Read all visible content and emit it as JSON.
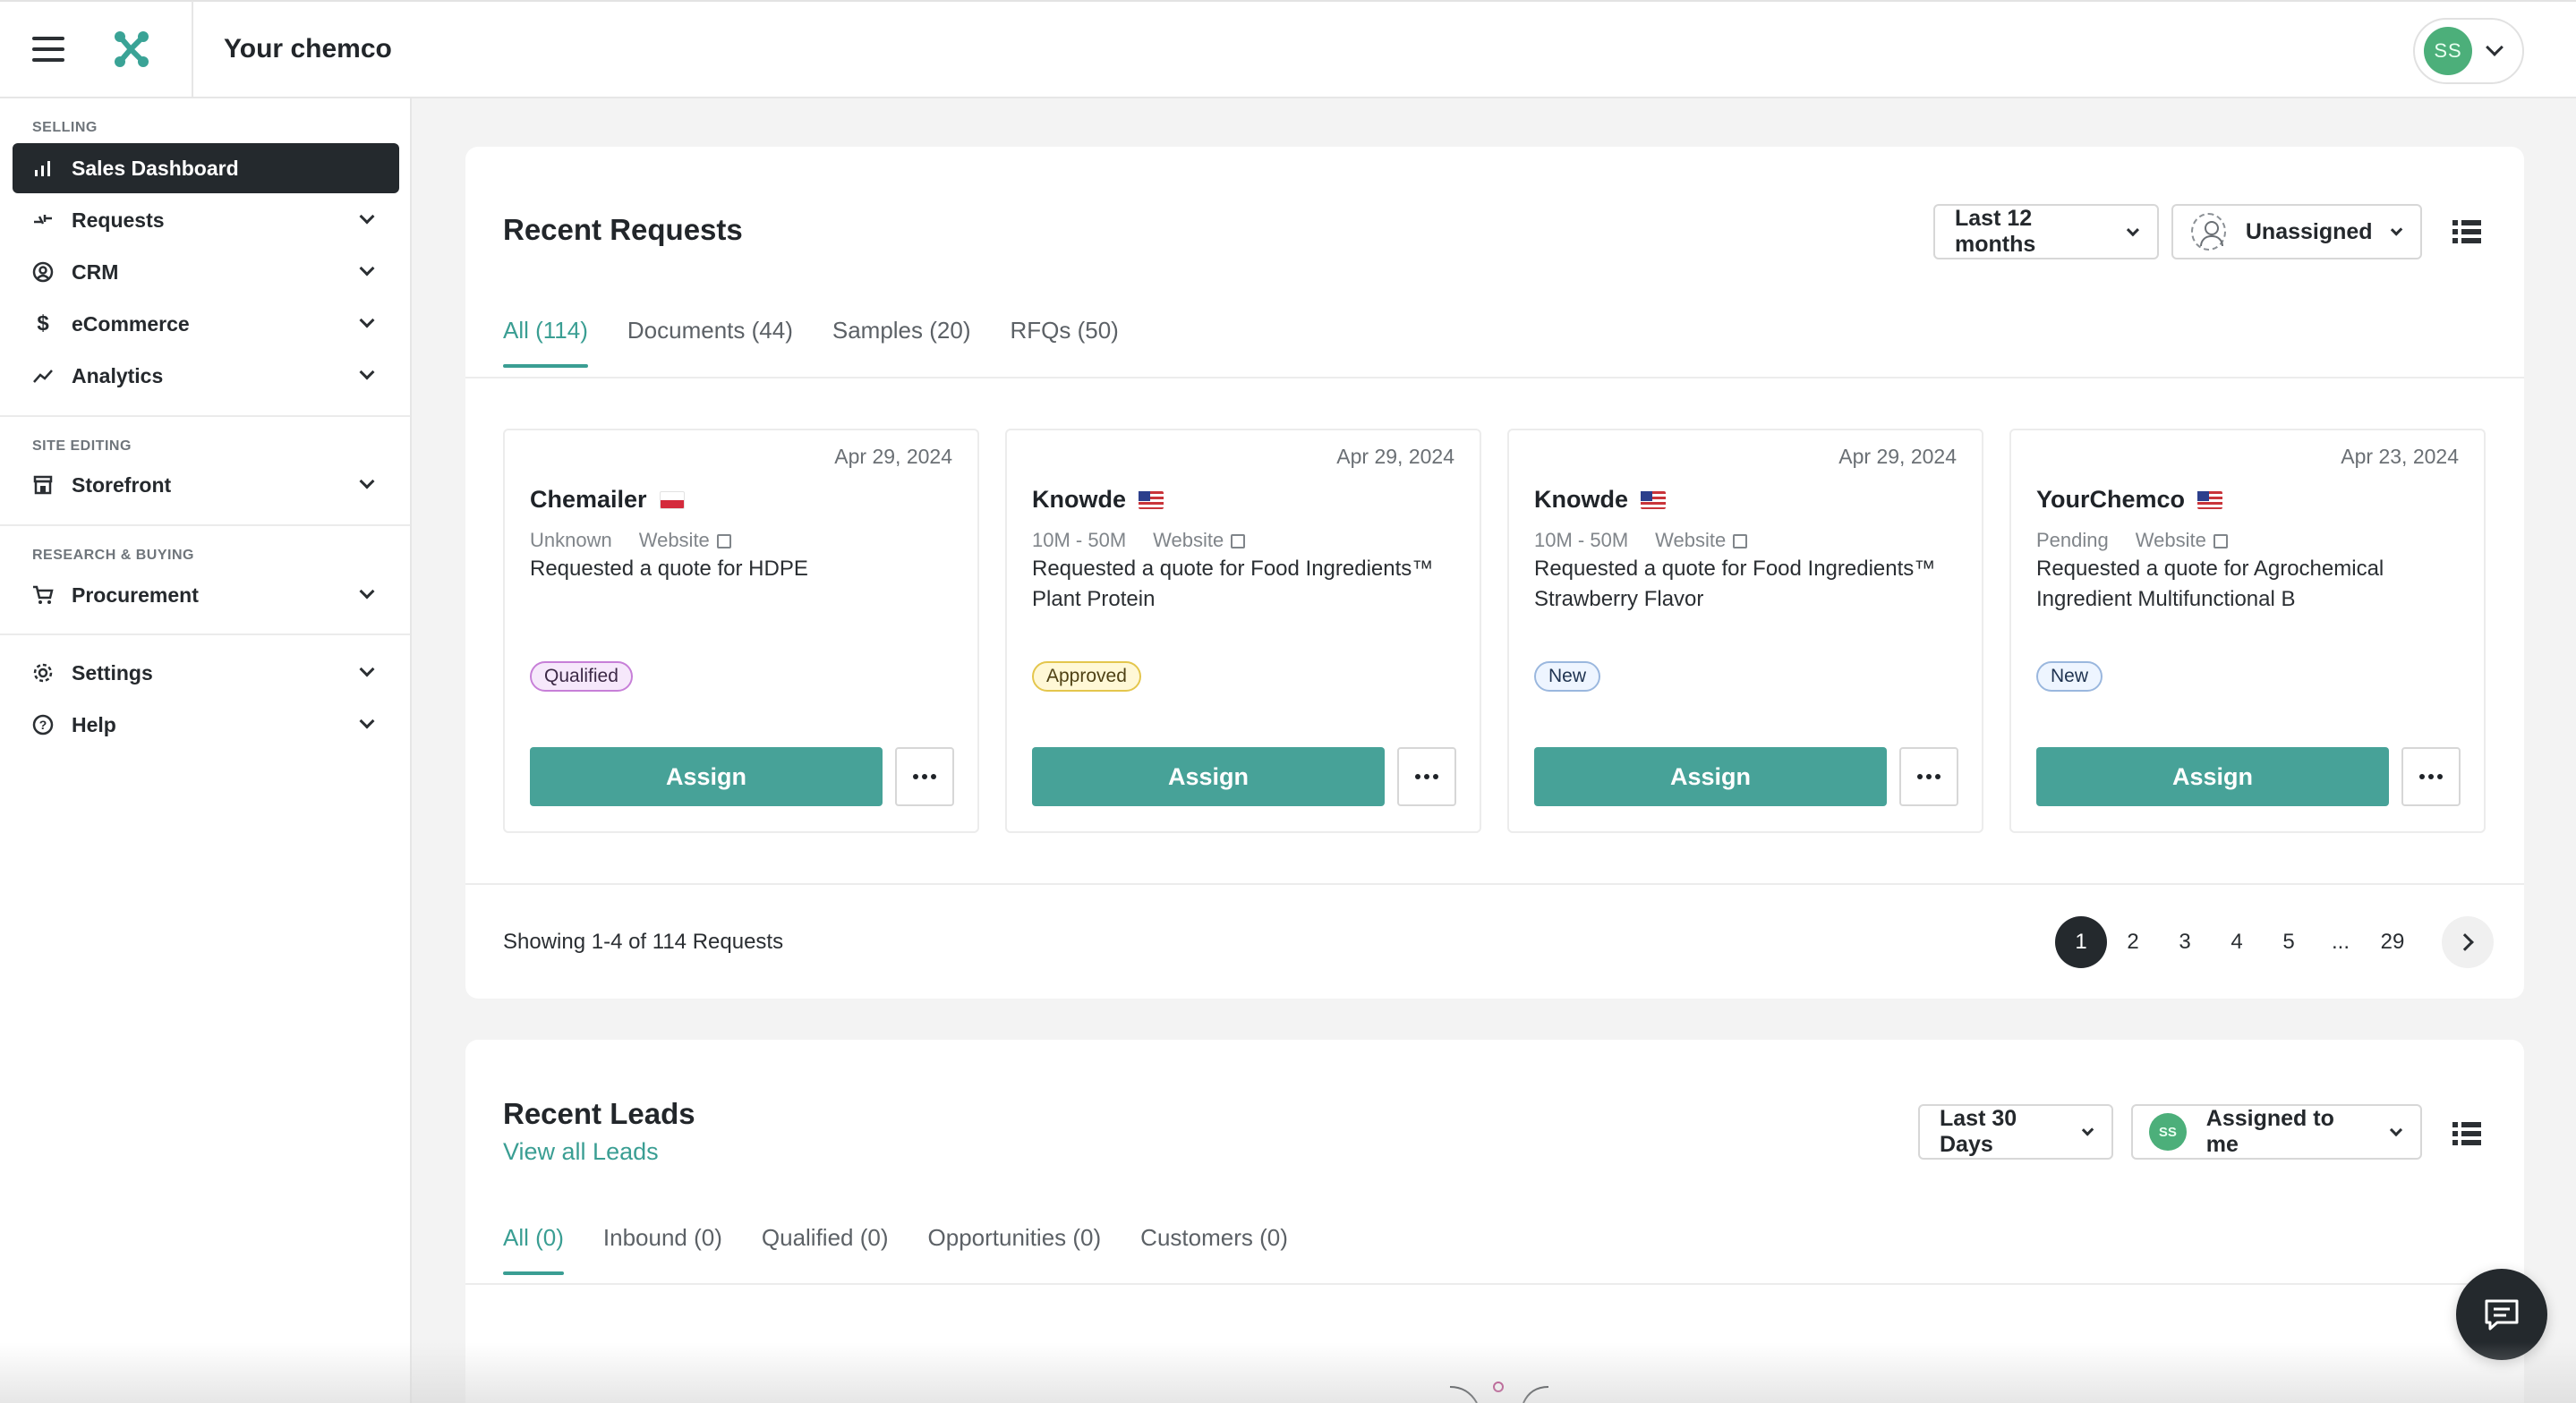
{
  "header": {
    "title": "Your chemco",
    "user_initials": "SS"
  },
  "sidebar": {
    "sections": [
      {
        "label": "SELLING"
      },
      {
        "label": "SITE EDITING"
      },
      {
        "label": "RESEARCH & BUYING"
      }
    ],
    "items": [
      {
        "label": "Sales Dashboard",
        "icon": "bar-chart-icon",
        "active": true
      },
      {
        "label": "Requests",
        "icon": "swap-icon"
      },
      {
        "label": "CRM",
        "icon": "user-circle-icon"
      },
      {
        "label": "eCommerce",
        "icon": "dollar-icon"
      },
      {
        "label": "Analytics",
        "icon": "trend-icon"
      },
      {
        "label": "Storefront",
        "icon": "storefront-icon"
      },
      {
        "label": "Procurement",
        "icon": "cart-icon"
      },
      {
        "label": "Settings",
        "icon": "gear-icon"
      },
      {
        "label": "Help",
        "icon": "help-icon"
      }
    ]
  },
  "requests": {
    "title": "Recent Requests",
    "period": "Last 12 months",
    "assignee": "Unassigned",
    "tabs": [
      "All (114)",
      "Documents (44)",
      "Samples (20)",
      "RFQs (50)"
    ],
    "cards": [
      {
        "date": "Apr 29, 2024",
        "company": "Chemailer",
        "flag": "PL",
        "size": "Unknown",
        "source": "Website",
        "description": "Requested a quote for HDPE",
        "status": "Qualified",
        "action": "Assign"
      },
      {
        "date": "Apr 29, 2024",
        "company": "Knowde",
        "flag": "US",
        "size": "10M - 50M",
        "source": "Website",
        "description": "Requested a quote for Food Ingredients™ Plant Protein",
        "status": "Approved",
        "action": "Assign"
      },
      {
        "date": "Apr 29, 2024",
        "company": "Knowde",
        "flag": "US",
        "size": "10M - 50M",
        "source": "Website",
        "description": "Requested a quote for Food Ingredients™ Strawberry Flavor",
        "status": "New",
        "action": "Assign"
      },
      {
        "date": "Apr 23, 2024",
        "company": "YourChemco",
        "flag": "US",
        "size": "Pending",
        "source": "Website",
        "description": "Requested a quote for Agrochemical Ingredient Multifunctional B",
        "status": "New",
        "action": "Assign"
      }
    ],
    "showing": "Showing 1-4 of 114 Requests",
    "pages": [
      "1",
      "2",
      "3",
      "4",
      "5",
      "...",
      "29"
    ],
    "current_page": "1"
  },
  "leads": {
    "title": "Recent Leads",
    "view_all": "View all Leads",
    "period": "Last 30 Days",
    "assignee": "Assigned to me",
    "assignee_initials": "SS",
    "tabs": [
      "All (0)",
      "Inbound (0)",
      "Qualified (0)",
      "Opportunities (0)",
      "Customers (0)"
    ]
  },
  "colors": {
    "accent": "#47a298",
    "dark": "#24292d",
    "avatar": "#4caf7a"
  }
}
